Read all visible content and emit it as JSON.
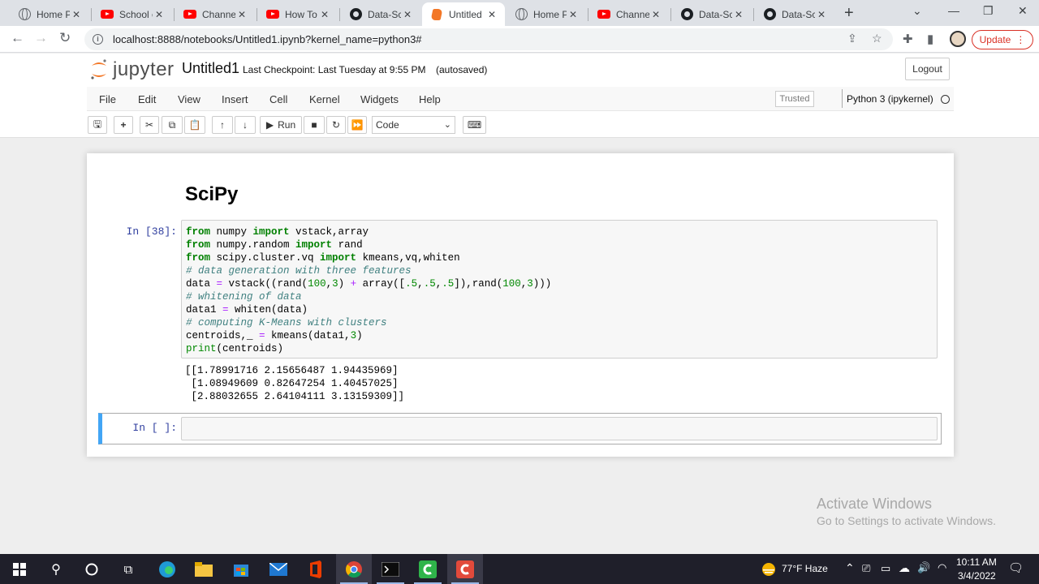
{
  "browser": {
    "tabs": [
      {
        "title": "Home P",
        "icon": "globe-icon"
      },
      {
        "title": "School c",
        "icon": "youtube-icon"
      },
      {
        "title": "Channel",
        "icon": "youtube-icon"
      },
      {
        "title": "How To",
        "icon": "youtube-icon"
      },
      {
        "title": "Data-Sc",
        "icon": "github-icon"
      },
      {
        "title": "Untitled",
        "icon": "jupyter-icon",
        "active": true
      },
      {
        "title": "Home P",
        "icon": "globe-icon"
      },
      {
        "title": "Channel",
        "icon": "youtube-icon"
      },
      {
        "title": "Data-Sc",
        "icon": "github-icon"
      },
      {
        "title": "Data-Sc",
        "icon": "github-icon"
      }
    ],
    "url": "localhost:8888/notebooks/Untitled1.ipynb?kernel_name=python3#",
    "update_label": "Update"
  },
  "jupyter": {
    "logo_text": "jupyter",
    "notebook_name": "Untitled1",
    "checkpoint": "Last Checkpoint: Last Tuesday at 9:55 PM",
    "autosave": "(autosaved)",
    "logout_label": "Logout",
    "menu": [
      "File",
      "Edit",
      "View",
      "Insert",
      "Cell",
      "Kernel",
      "Widgets",
      "Help"
    ],
    "trusted": "Trusted",
    "kernel": "Python 3 (ipykernel)",
    "run_label": "Run",
    "cell_type": "Code"
  },
  "notebook": {
    "heading": "SciPy",
    "cell1": {
      "prompt": "In [38]:",
      "code": [
        "from numpy import vstack,array",
        "from numpy.random import rand",
        "from scipy.cluster.vq import kmeans,vq,whiten",
        "# data generation with three features",
        "data = vstack((rand(100,3) + array([.5,.5,.5]),rand(100,3)))",
        "# whitening of data",
        "data1 = whiten(data)",
        "# computing K-Means with clusters",
        "centroids,_ = kmeans(data1,3)",
        "print(centroids)"
      ],
      "output": [
        "[[1.78991716 2.15656487 1.94435969]",
        " [1.08949609 0.82647254 1.40457025]",
        " [2.88032655 2.64104111 3.13159309]]"
      ]
    },
    "cell2": {
      "prompt": "In [ ]:"
    }
  },
  "watermark": {
    "line1": "Activate Windows",
    "line2": "Go to Settings to activate Windows."
  },
  "taskbar": {
    "weather": "77°F  Haze",
    "time": "10:11 AM",
    "date": "3/4/2022"
  }
}
